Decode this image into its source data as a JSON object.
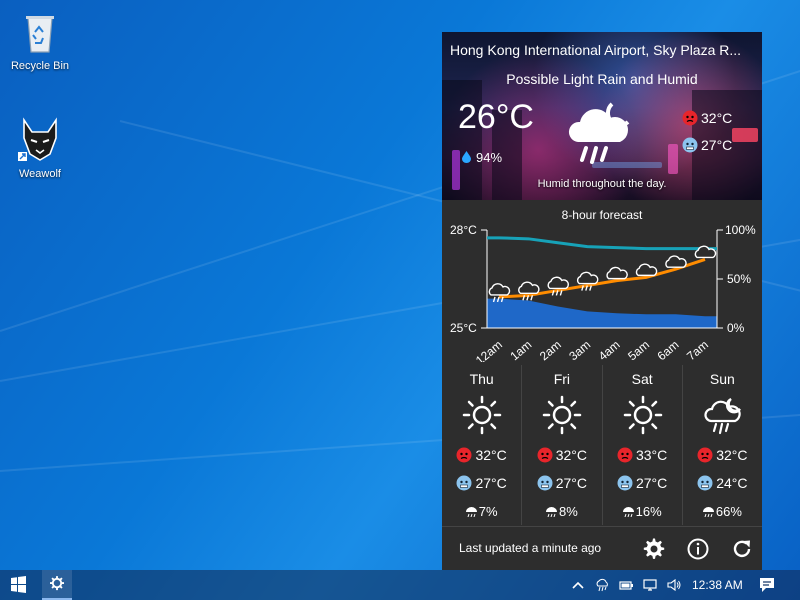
{
  "desktop": {
    "icons": [
      {
        "label": "Recycle Bin",
        "icon": "recycle-bin-icon"
      },
      {
        "label": "Weawolf",
        "icon": "wolf-app-icon"
      }
    ]
  },
  "widget": {
    "location": "Hong Kong International Airport, Sky Plaza R...",
    "condition": "Possible Light Rain and Humid",
    "temperature": "26°C",
    "humidity": "94%",
    "high": "32°C",
    "low": "27°C",
    "description": "Humid throughout the day.",
    "current_icon": "rain-cloud-moon-icon",
    "chart_title": "8-hour forecast",
    "footer": {
      "updated": "Last updated a minute ago"
    },
    "days": [
      {
        "name": "Thu",
        "icon": "sun-icon",
        "high": "32°C",
        "low": "27°C",
        "rain": "7%"
      },
      {
        "name": "Fri",
        "icon": "sun-icon",
        "high": "32°C",
        "low": "27°C",
        "rain": "8%"
      },
      {
        "name": "Sat",
        "icon": "sun-icon",
        "high": "33°C",
        "low": "27°C",
        "rain": "16%"
      },
      {
        "name": "Sun",
        "icon": "rain-cloud-icon",
        "high": "32°C",
        "low": "24°C",
        "rain": "66%"
      }
    ],
    "colors": {
      "temp_line": "#ff8c00",
      "humidity_line": "#17a2b8",
      "precip_area": "#1e6fd9"
    }
  },
  "chart_data": {
    "type": "line",
    "title": "8-hour forecast",
    "categories": [
      "12am",
      "1am",
      "2am",
      "3am",
      "4am",
      "5am",
      "6am",
      "7am"
    ],
    "left_axis": {
      "min": 25,
      "max": 28,
      "ticks": [
        "25°C",
        "28°C"
      ]
    },
    "right_axis": {
      "min": 0,
      "max": 100,
      "ticks": [
        "0%",
        "50%",
        "100%"
      ]
    },
    "series": [
      {
        "values": [
          25.95,
          26.0,
          26.15,
          26.3,
          26.45,
          26.55,
          26.8,
          27.1
        ]
      },
      {
        "values": [
          92,
          91,
          87,
          83,
          82,
          81,
          81,
          81
        ]
      },
      {
        "values": [
          30,
          28,
          22,
          17,
          15,
          14,
          14,
          12
        ]
      }
    ]
  },
  "taskbar": {
    "clock": "12:38 AM"
  }
}
